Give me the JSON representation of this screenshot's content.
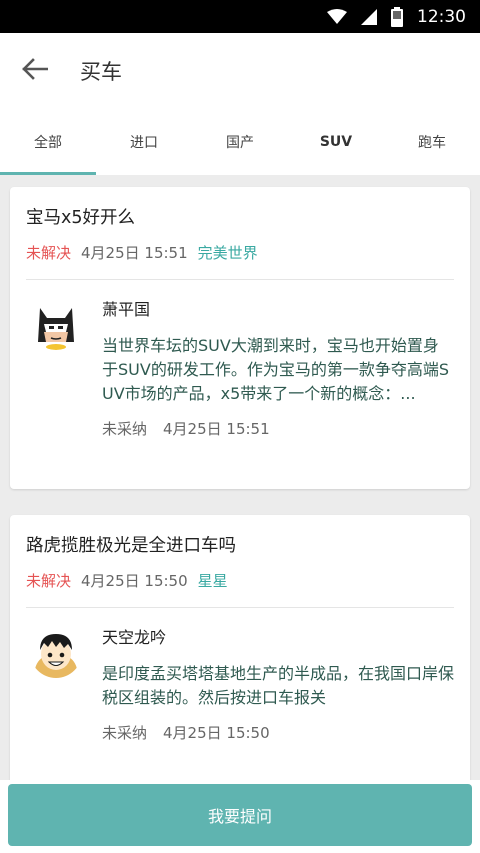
{
  "status_bar": {
    "time": "12:30",
    "icons": [
      "wifi-icon",
      "signal-icon",
      "battery-icon"
    ]
  },
  "toolbar": {
    "back_icon": "arrow-left-icon",
    "title": "买车"
  },
  "tabs": [
    {
      "label": "全部",
      "active": true
    },
    {
      "label": "进口",
      "active": false
    },
    {
      "label": "国产",
      "active": false
    },
    {
      "label": "SUV",
      "active": false
    },
    {
      "label": "跑车",
      "active": false
    }
  ],
  "questions": [
    {
      "title": "宝马x5好开么",
      "status": "未解决",
      "time": "4月25日 15:51",
      "asker": "完美世界",
      "answer": {
        "author": "萧平国",
        "avatar": "batman-avatar",
        "body": "当世界车坛的SUV大潮到来时，宝马也开始置身于SUV的研发工作。作为宝马的第一款争夺高端SUV市场的产品，x5带来了一个新的概念：...",
        "status": "未采纳",
        "time": "4月25日 15:51"
      }
    },
    {
      "title": "路虎揽胜极光是全进口车吗",
      "status": "未解决",
      "time": "4月25日 15:50",
      "asker": "星星",
      "answer": {
        "author": "天空龙吟",
        "avatar": "luffy-avatar",
        "body": "是印度孟买塔塔基地生产的半成品，在我国口岸保税区组装的。然后按进口车报关",
        "status": "未采纳",
        "time": "4月25日 15:50"
      }
    }
  ],
  "bottom": {
    "ask_label": "我要提问"
  },
  "colors": {
    "accent": "#5fb4b0",
    "unresolved": "#e55353",
    "asker": "#3aa9a2",
    "answer_text": "#2f5a50"
  }
}
